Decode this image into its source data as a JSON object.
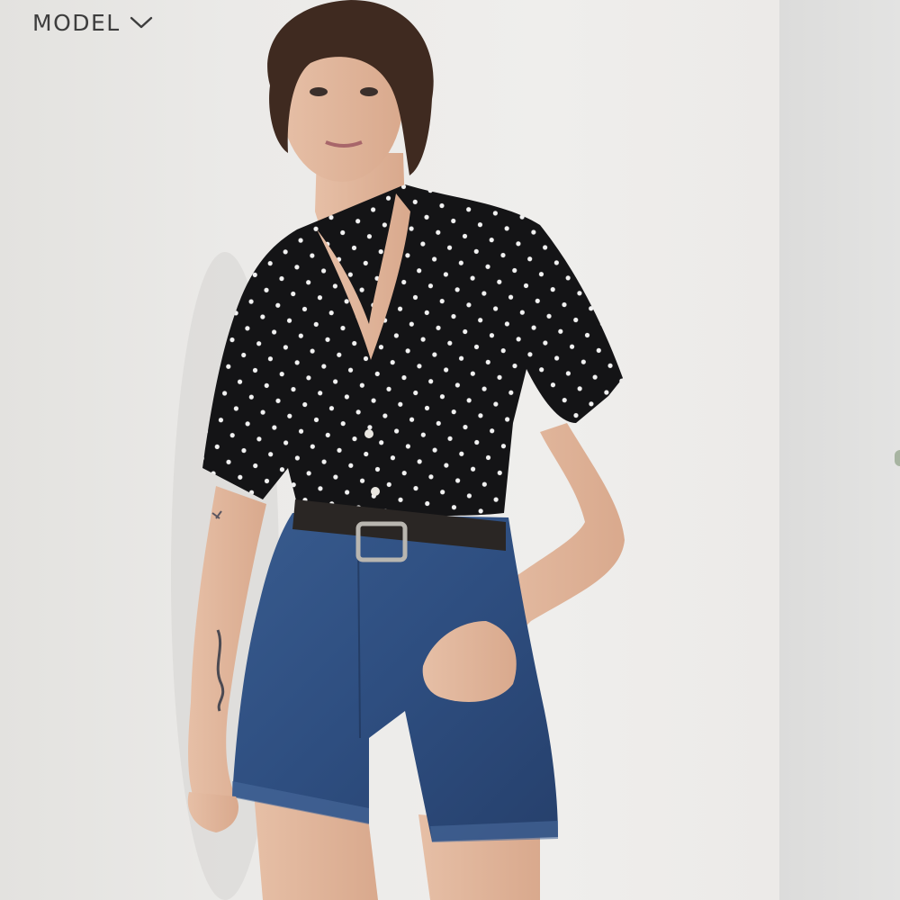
{
  "model_toggle": {
    "label": "MODEL",
    "icon": "chevron-down-icon"
  },
  "photo": {
    "subject": "model-wearing-polka-dot-shirt-and-denim-shorts"
  },
  "colors": {
    "label_text": "#3d3d3d",
    "background_wall": "#ecebe9",
    "side_panel": "#e0e0df",
    "shirt": "#141416",
    "denim": "#2f4f80",
    "belt": "#2a2624"
  }
}
